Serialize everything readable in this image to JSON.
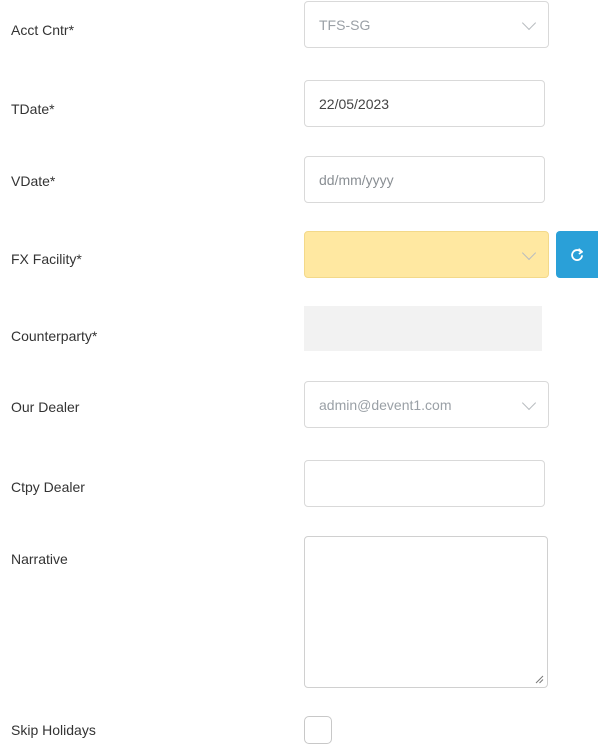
{
  "form": {
    "acct_cntr": {
      "label": "Acct Cntr*",
      "value": "TFS-SG"
    },
    "tdate": {
      "label": "TDate*",
      "value": "22/05/2023"
    },
    "vdate": {
      "label": "VDate*",
      "placeholder": "dd/mm/yyyy"
    },
    "fx_facility": {
      "label": "FX Facility*",
      "value": ""
    },
    "counterparty": {
      "label": "Counterparty*",
      "value": ""
    },
    "our_dealer": {
      "label": "Our Dealer",
      "value": "admin@devent1.com"
    },
    "ctpy_dealer": {
      "label": "Ctpy Dealer",
      "value": ""
    },
    "narrative": {
      "label": "Narrative",
      "value": ""
    },
    "skip_holidays": {
      "label": "Skip Holidays",
      "checked": false
    }
  },
  "colors": {
    "highlight_field": "#ffe8a1",
    "refresh_button": "#2aa0d8"
  },
  "icons": {
    "dropdown": "chevron-down-icon",
    "refresh": "refresh-icon",
    "resize": "resize-grip-icon"
  }
}
